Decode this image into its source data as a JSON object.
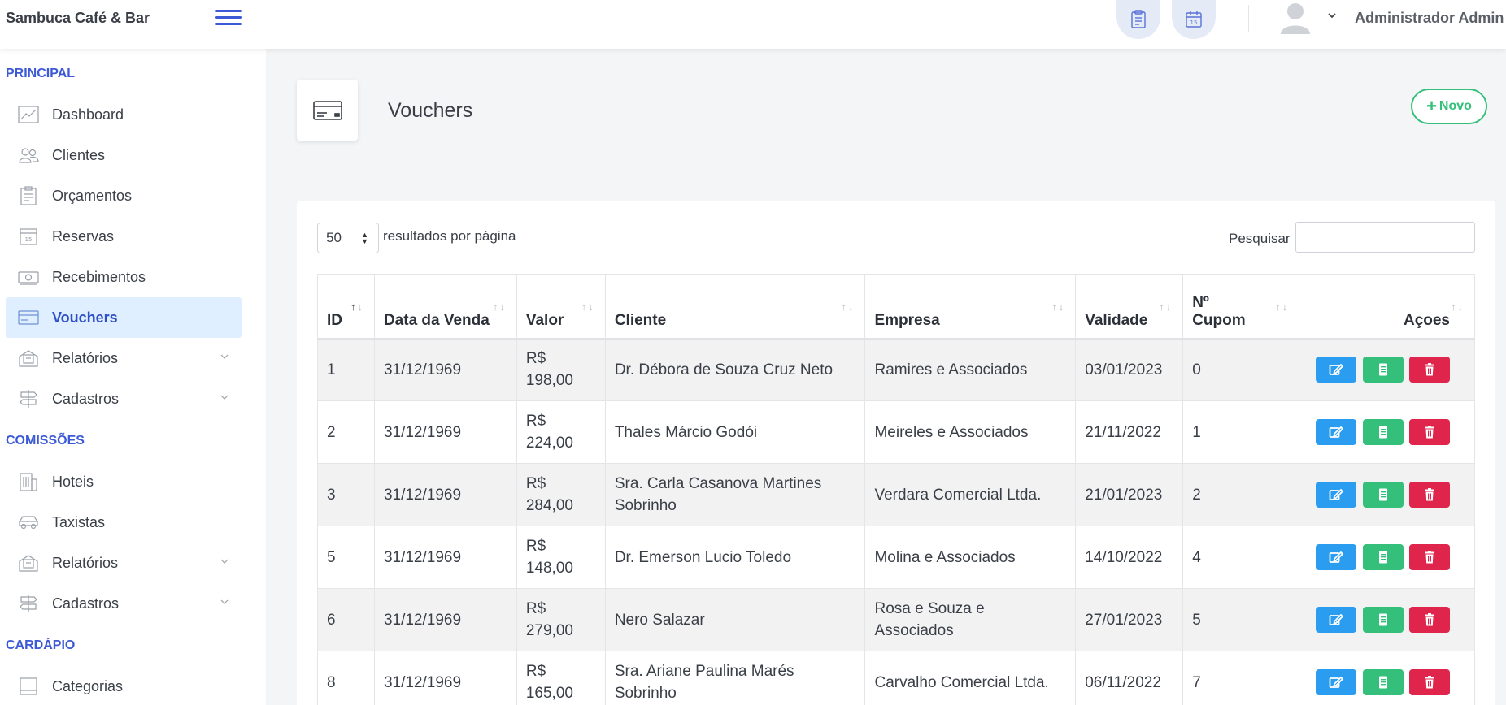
{
  "app": {
    "title": "Sambuca Café & Bar",
    "user": "Administrador Admin"
  },
  "topbar": {
    "icons": [
      "clipboard-icon",
      "calendar-icon"
    ]
  },
  "sidebar": {
    "sections": [
      {
        "title": "PRINCIPAL",
        "items": [
          {
            "label": "Dashboard",
            "icon": "chart-line-icon"
          },
          {
            "label": "Clientes",
            "icon": "users-icon"
          },
          {
            "label": "Orçamentos",
            "icon": "clipboard-icon"
          },
          {
            "label": "Reservas",
            "icon": "calendar-icon"
          },
          {
            "label": "Recebimentos",
            "icon": "money-icon"
          },
          {
            "label": "Vouchers",
            "icon": "credit-card-icon",
            "active": true
          },
          {
            "label": "Relatórios",
            "icon": "report-icon",
            "expandable": true
          },
          {
            "label": "Cadastros",
            "icon": "signpost-icon",
            "expandable": true
          }
        ]
      },
      {
        "title": "COMISSÕES",
        "items": [
          {
            "label": "Hoteis",
            "icon": "building-icon"
          },
          {
            "label": "Taxistas",
            "icon": "car-icon"
          },
          {
            "label": "Relatórios",
            "icon": "report-icon",
            "expandable": true
          },
          {
            "label": "Cadastros",
            "icon": "signpost-icon",
            "expandable": true
          }
        ]
      },
      {
        "title": "CARDÁPIO",
        "items": [
          {
            "label": "Categorias",
            "icon": "category-icon"
          }
        ]
      }
    ]
  },
  "page": {
    "title": "Vouchers",
    "new_button": "Novo"
  },
  "table_controls": {
    "page_length": "50",
    "page_length_label": "resultados por página",
    "search_label": "Pesquisar",
    "search_value": ""
  },
  "table": {
    "columns": [
      "ID",
      "Data da Venda",
      "Valor",
      "Cliente",
      "Empresa",
      "Validade",
      "Nº Cupom",
      "Açoes"
    ],
    "rows": [
      {
        "id": "1",
        "date": "31/12/1969",
        "value": "R$ 198,00",
        "client": "Dr. Débora de Souza Cruz Neto",
        "company": "Ramires e Associados",
        "validity": "03/01/2023",
        "coupon": "0"
      },
      {
        "id": "2",
        "date": "31/12/1969",
        "value": "R$ 224,00",
        "client": "Thales Márcio Godói",
        "company": "Meireles e Associados",
        "validity": "21/11/2022",
        "coupon": "1"
      },
      {
        "id": "3",
        "date": "31/12/1969",
        "value": "R$ 284,00",
        "client": "Sra. Carla Casanova Martines Sobrinho",
        "company": "Verdara Comercial Ltda.",
        "validity": "21/01/2023",
        "coupon": "2"
      },
      {
        "id": "5",
        "date": "31/12/1969",
        "value": "R$ 148,00",
        "client": "Dr. Emerson Lucio Toledo",
        "company": "Molina e Associados",
        "validity": "14/10/2022",
        "coupon": "4"
      },
      {
        "id": "6",
        "date": "31/12/1969",
        "value": "R$ 279,00",
        "client": "Nero Salazar",
        "company": "Rosa e Souza e Associados",
        "validity": "27/01/2023",
        "coupon": "5"
      },
      {
        "id": "8",
        "date": "31/12/1969",
        "value": "R$ 165,00",
        "client": "Sra. Ariane Paulina Marés Sobrinho",
        "company": "Carvalho Comercial Ltda.",
        "validity": "06/11/2022",
        "coupon": "7"
      }
    ]
  },
  "colors": {
    "accent": "#3d5ad6",
    "active_bg": "#dfefff",
    "edit": "#2b9df0",
    "doc": "#34c07a",
    "delete": "#e0254d"
  }
}
